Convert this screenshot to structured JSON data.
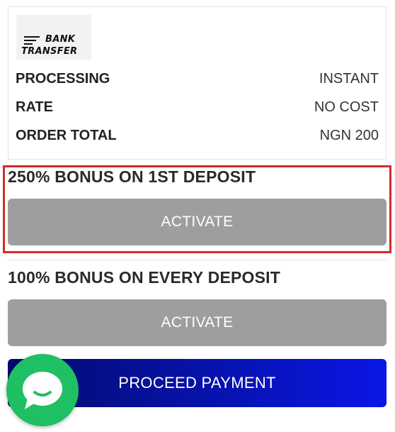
{
  "payment_method": {
    "logo_line1": "BANK",
    "logo_line2": "TRANSFER"
  },
  "details": [
    {
      "label": "PROCESSING",
      "value": "INSTANT"
    },
    {
      "label": "RATE",
      "value": "NO COST"
    },
    {
      "label": "ORDER TOTAL",
      "value": "NGN 200"
    }
  ],
  "bonuses": [
    {
      "title": "250% BONUS ON 1ST DEPOSIT",
      "button": "ACTIVATE"
    },
    {
      "title": "100% BONUS ON EVERY DEPOSIT",
      "button": "ACTIVATE"
    }
  ],
  "proceed_label": "PROCEED PAYMENT",
  "colors": {
    "highlight_border": "#d42a2a",
    "activate_bg": "#9e9e9e",
    "proceed_gradient_start": "#040b6b",
    "proceed_gradient_end": "#0a16e6",
    "chat_bubble": "#1fbf63"
  },
  "icons": {
    "logo_lines": "speed-lines-icon",
    "chat": "chat-bubble-icon"
  }
}
